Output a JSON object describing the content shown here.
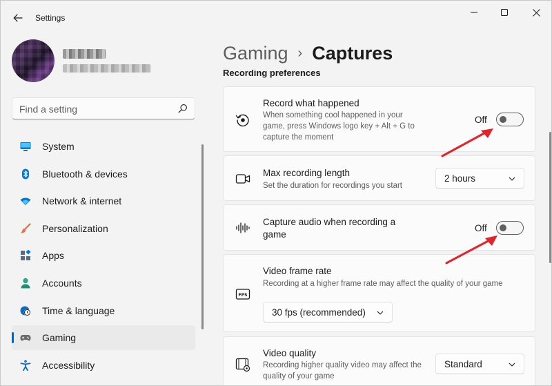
{
  "window": {
    "title": "Settings",
    "controls": {
      "minimize": "minimize",
      "maximize": "maximize",
      "close": "close"
    }
  },
  "profile": {
    "name": "",
    "email": ""
  },
  "search": {
    "placeholder": "Find a setting",
    "value": ""
  },
  "sidebar": {
    "items": [
      {
        "label": "System",
        "icon": "monitor-icon",
        "active": false
      },
      {
        "label": "Bluetooth & devices",
        "icon": "bluetooth-icon",
        "active": false
      },
      {
        "label": "Network & internet",
        "icon": "wifi-icon",
        "active": false
      },
      {
        "label": "Personalization",
        "icon": "paintbrush-icon",
        "active": false
      },
      {
        "label": "Apps",
        "icon": "apps-icon",
        "active": false
      },
      {
        "label": "Accounts",
        "icon": "person-icon",
        "active": false
      },
      {
        "label": "Time & language",
        "icon": "globe-clock-icon",
        "active": false
      },
      {
        "label": "Gaming",
        "icon": "gamepad-icon",
        "active": true
      },
      {
        "label": "Accessibility",
        "icon": "accessibility-icon",
        "active": false
      }
    ]
  },
  "main": {
    "breadcrumb": {
      "parent": "Gaming",
      "separator": "›",
      "current": "Captures"
    },
    "section_title": "Recording preferences",
    "cards": {
      "record_what_happened": {
        "title": "Record what happened",
        "description": "When something cool happened in your game, press Windows logo key + Alt + G to capture the moment",
        "toggle_label": "Off",
        "toggle_on": false
      },
      "max_recording_length": {
        "title": "Max recording length",
        "description": "Set the duration for recordings you start",
        "dropdown_value": "2 hours"
      },
      "capture_audio": {
        "title": "Capture audio when recording a game",
        "toggle_label": "Off",
        "toggle_on": false
      },
      "video_frame_rate": {
        "title": "Video frame rate",
        "description": "Recording at a higher frame rate may affect the quality of your game",
        "dropdown_value": "30 fps (recommended)"
      },
      "video_quality": {
        "title": "Video quality",
        "description": "Recording higher quality video may affect the quality of your game",
        "dropdown_value": "Standard"
      }
    }
  },
  "colors": {
    "accent": "#0067c0",
    "annotation_arrow": "#e0242b",
    "background": "#f3f3f3",
    "card": "#fbfbfb"
  }
}
